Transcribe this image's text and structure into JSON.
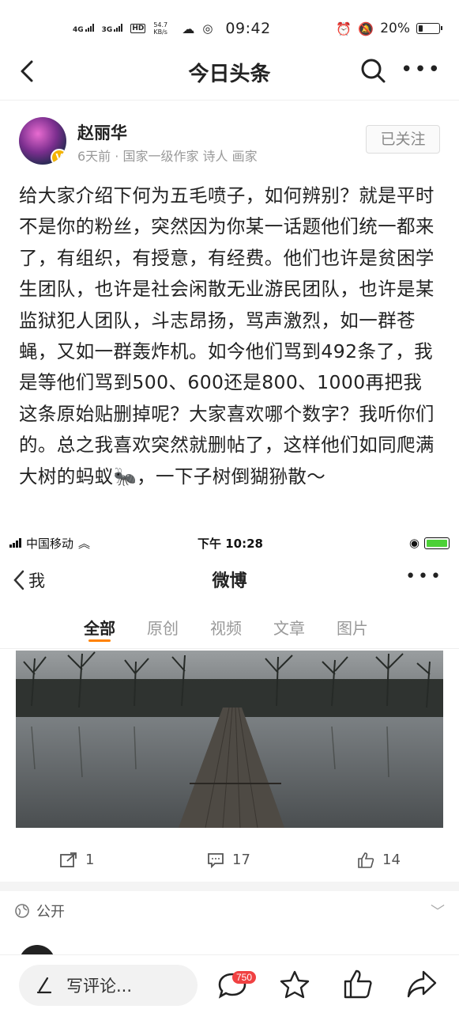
{
  "status_bar": {
    "net1": "4G",
    "net2": "3G",
    "hd": "HD",
    "speed": "54.7 KB/s",
    "time": "09:42",
    "battery": "20%",
    "battery_level": 0.2
  },
  "header": {
    "title": "今日头条"
  },
  "author": {
    "name": "赵丽华",
    "meta": "6天前 · 国家一级作家 诗人 画家",
    "follow_label": "已关注"
  },
  "article": {
    "text": "给大家介绍下何为五毛喷子，如何辨别？就是平时不是你的粉丝，突然因为你某一话题他们统一都来了，有组织，有授意，有经费。他们也许是贫困学生团队，也许是社会闲散无业游民团队，也许是某监狱犯人团队，斗志昂扬，骂声激烈，如一群苍蝇，又如一群轰炸机。如今他们骂到492条了，我是等他们骂到500、600还是800、1000再把我这条原始贴删掉呢？大家喜欢哪个数字？我听你们的。总之我喜欢突然就删帖了，这样他们如同爬满大树的蚂蚁🐜，一下子树倒猢狲散～"
  },
  "embed": {
    "status": {
      "carrier": "中国移动",
      "time": "下午 10:28"
    },
    "nav": {
      "back_label": "我",
      "title": "微博"
    },
    "tabs": [
      "全部",
      "原创",
      "视频",
      "文章",
      "图片"
    ],
    "actions": {
      "repost": "1",
      "comment": "17",
      "like": "14"
    },
    "visibility": "公开"
  },
  "bottom_bar": {
    "comment_placeholder": "写评论...",
    "comment_count": "750"
  }
}
